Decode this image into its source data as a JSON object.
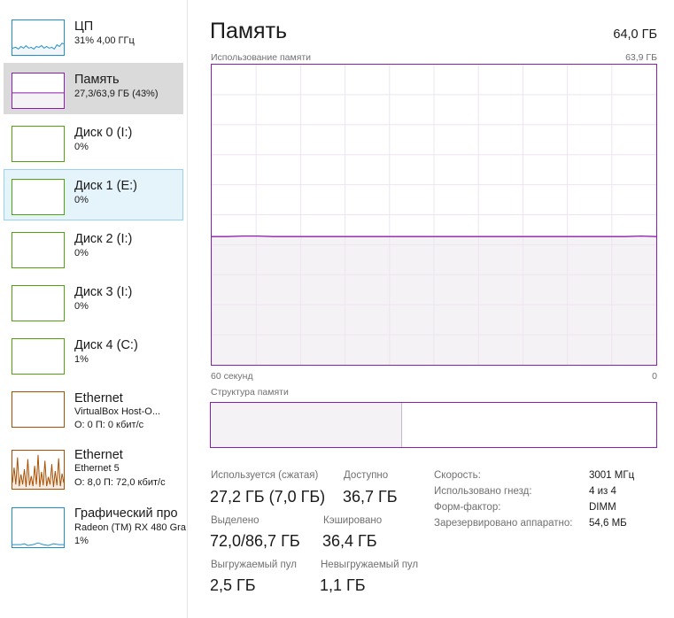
{
  "sidebar": {
    "items": [
      {
        "title": "ЦП",
        "line1": "31% 4,00 ГГц",
        "line2": "",
        "color": "#1e90c8",
        "state": "normal"
      },
      {
        "title": "Память",
        "line1": "27,3/63,9 ГБ (43%)",
        "line2": "",
        "color": "#8b1fa9",
        "state": "selected"
      },
      {
        "title": "Диск 0 (I:)",
        "line1": "0%",
        "line2": "",
        "color": "#4da60c",
        "state": "normal"
      },
      {
        "title": "Диск 1 (E:)",
        "line1": "0%",
        "line2": "",
        "color": "#4da60c",
        "state": "hovered"
      },
      {
        "title": "Диск 2 (I:)",
        "line1": "0%",
        "line2": "",
        "color": "#4da60c",
        "state": "normal"
      },
      {
        "title": "Диск 3 (I:)",
        "line1": "0%",
        "line2": "",
        "color": "#4da60c",
        "state": "normal"
      },
      {
        "title": "Диск 4 (C:)",
        "line1": "1%",
        "line2": "",
        "color": "#4da60c",
        "state": "normal"
      },
      {
        "title": "Ethernet",
        "line1": "VirtualBox Host-O...",
        "line2": "О: 0 П: 0 кбит/с",
        "color": "#a74f01",
        "state": "normal"
      },
      {
        "title": "Ethernet",
        "line1": "Ethernet 5",
        "line2": "О: 8,0 П: 72,0 кбит/с",
        "color": "#a74f01",
        "state": "normal"
      },
      {
        "title": "Графический про",
        "line1": "Radeon (TM) RX 480 Gra",
        "line2": "1%",
        "color": "#1e90c8",
        "state": "normal"
      }
    ]
  },
  "main": {
    "title": "Память",
    "total": "64,0 ГБ",
    "usage_label": "Использование памяти",
    "usage_max": "63,9 ГБ",
    "time_left": "60 секунд",
    "time_right": "0",
    "structure_label": "Структура памяти",
    "accent_color": "#8b1fa9"
  },
  "chart_data": {
    "type": "area",
    "xlabel": "",
    "ylabel": "",
    "x_range_seconds": [
      60,
      0
    ],
    "y_range_gb": [
      0,
      63.9
    ],
    "series": [
      {
        "values": [
          27.3,
          27.3,
          27.4,
          27.4,
          27.3,
          27.3,
          27.3,
          27.3,
          27.3,
          27.3,
          27.3,
          27.3,
          27.3,
          27.3,
          27.3,
          27.3,
          27.3,
          27.3,
          27.3,
          27.3,
          27.3,
          27.3,
          27.3,
          27.3,
          27.3,
          27.3,
          27.3,
          27.3,
          27.4,
          27.3
        ]
      }
    ],
    "grid": true
  },
  "structure": {
    "used_fraction": 0.43
  },
  "stats": {
    "in_use_label": "Используется (сжатая)",
    "in_use_value": "27,2 ГБ (7,0 ГБ)",
    "available_label": "Доступно",
    "available_value": "36,7 ГБ",
    "committed_label": "Выделено",
    "committed_value": "72,0/86,7 ГБ",
    "cached_label": "Кэшировано",
    "cached_value": "36,4 ГБ",
    "paged_label": "Выгружаемый пул",
    "paged_value": "2,5 ГБ",
    "nonpaged_label": "Невыгружаемый пул",
    "nonpaged_value": "1,1 ГБ"
  },
  "properties": {
    "speed_label": "Скорость:",
    "speed_value": "3001 МГц",
    "slots_label": "Использовано гнезд:",
    "slots_value": "4 из 4",
    "form_label": "Форм-фактор:",
    "form_value": "DIMM",
    "reserved_label": "Зарезервировано аппаратно:",
    "reserved_value": "54,6 МБ"
  }
}
